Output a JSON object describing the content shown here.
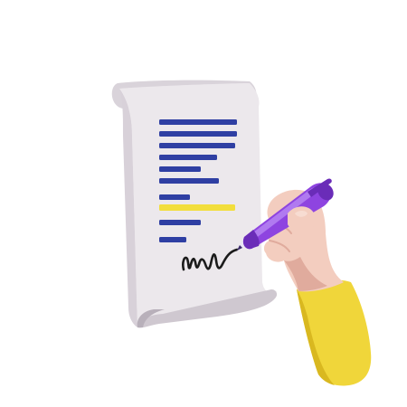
{
  "illustration": {
    "colors": {
      "background": "#ffffff",
      "paper": "#ece8ec",
      "paper_shadow": "#cfc8d0",
      "paper_edge": "#b8b0ba",
      "text_line": "#2f3fa3",
      "highlight": "#f2de3c",
      "signature": "#1b1b1b",
      "skin": "#f3cdbf",
      "skin_shadow": "#e0ab9d",
      "sleeve": "#f0d63a",
      "sleeve_shadow": "#d9b820",
      "pen_body": "#8e44e0",
      "pen_dark": "#6a2cb8",
      "pen_light": "#b07af0"
    },
    "icons": [
      "document-scroll-icon",
      "signature-mark",
      "pen-icon",
      "hand-icon"
    ]
  }
}
